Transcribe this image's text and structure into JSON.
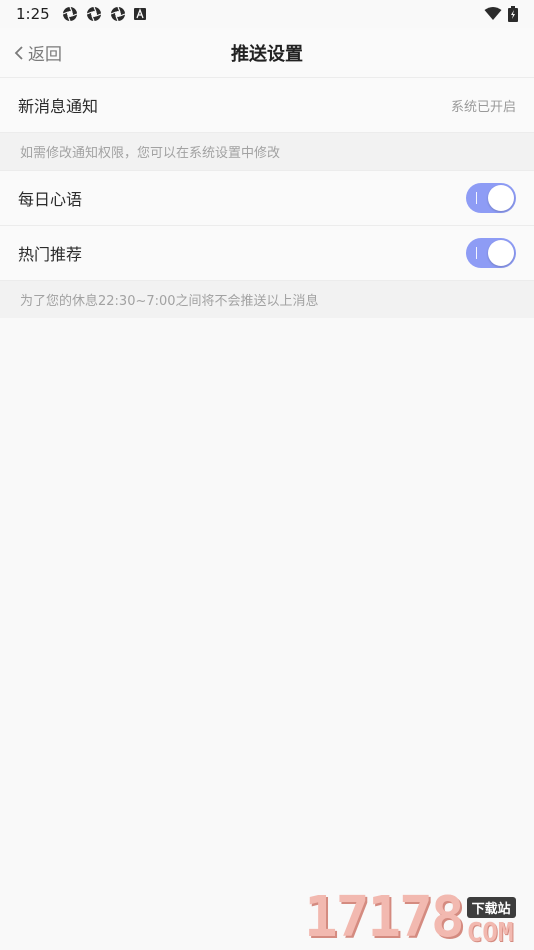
{
  "status_bar": {
    "time": "1:25",
    "left_icons": [
      "aperture-icon",
      "aperture-icon",
      "aperture-icon",
      "font-a-icon"
    ],
    "right_icons": [
      "wifi-icon",
      "battery-charging-icon"
    ]
  },
  "nav": {
    "back_label": "返回",
    "title": "推送设置"
  },
  "notification_row": {
    "label": "新消息通知",
    "value": "系统已开启"
  },
  "permission_hint": "如需修改通知权限，您可以在系统设置中修改",
  "toggles": [
    {
      "label": "每日心语",
      "on": true
    },
    {
      "label": "热门推荐",
      "on": true
    }
  ],
  "quiet_hint": "为了您的休息22:30~7:00之间将不会推送以上消息",
  "colors": {
    "accent": "#8e9cf5",
    "background": "#f9f9f9",
    "hint_background": "#f2f2f2"
  },
  "watermark": {
    "digits": "17178",
    "tag": "下载站",
    "suffix": "COM"
  }
}
